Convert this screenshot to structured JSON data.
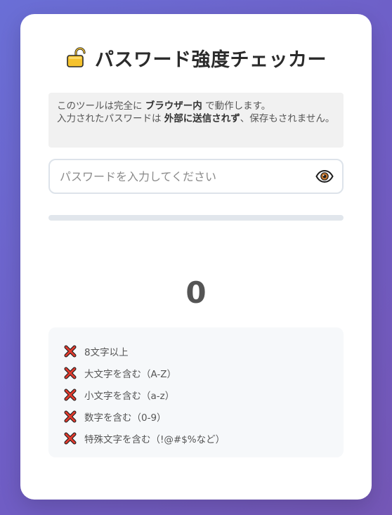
{
  "header": {
    "icon": "lock-icon",
    "title": "パスワード強度チェッカー"
  },
  "notice": {
    "line1_pre": "このツールは完全に",
    "line1_bold": "ブラウザー内",
    "line1_post": "で動作します。",
    "line2_pre": "入力されたパスワードは",
    "line2_bold": "外部に送信されず",
    "line2_post": "、保存もされません。"
  },
  "password": {
    "value": "",
    "placeholder": "パスワードを入力してください",
    "toggle_icon": "eye-icon"
  },
  "strength": {
    "fraction": 0,
    "score": "0",
    "bar_color": "#e74c3c"
  },
  "rules": [
    {
      "label": "8文字以上",
      "met": false,
      "icon": "cross-icon"
    },
    {
      "label": "大文字を含む（A-Z）",
      "met": false,
      "icon": "cross-icon"
    },
    {
      "label": "小文字を含む（a-z）",
      "met": false,
      "icon": "cross-icon"
    },
    {
      "label": "数字を含む（0-9）",
      "met": false,
      "icon": "cross-icon"
    },
    {
      "label": "特殊文字を含む（!@#$%など）",
      "met": false,
      "icon": "cross-icon"
    }
  ],
  "colors": {
    "background_start": "#6a6fd6",
    "background_end": "#7457b6",
    "card": "#ffffff",
    "cross": "#e23b2e"
  }
}
